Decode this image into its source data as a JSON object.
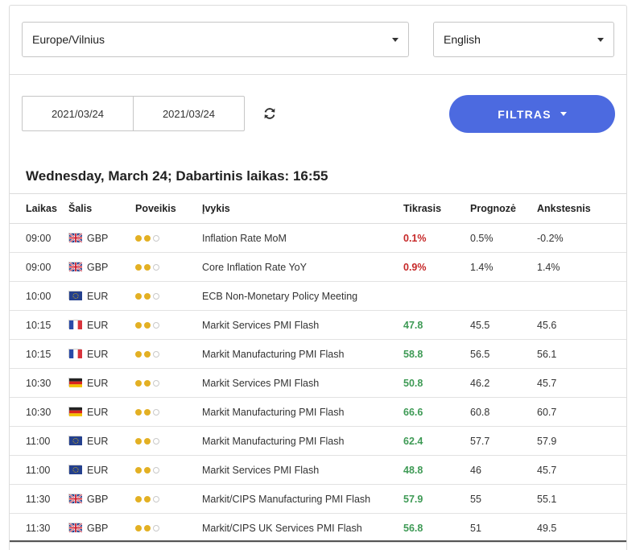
{
  "filters": {
    "timezone": "Europe/Vilnius",
    "language": "English",
    "date_from": "2021/03/24",
    "date_to": "2021/03/24",
    "filter_label": "FILTRAS"
  },
  "heading": "Wednesday, March 24; Dabartinis laikas: 16:55",
  "columns": {
    "time": "Laikas",
    "country": "Šalis",
    "impact": "Poveikis",
    "event": "Įvykis",
    "actual": "Tikrasis",
    "forecast": "Prognozė",
    "previous": "Ankstesnis"
  },
  "colors": {
    "accent": "#4c6ae0",
    "actual_up": "#3e9a55",
    "actual_down": "#c62828",
    "impact_dot": "#e3b023"
  },
  "events": [
    {
      "time": "09:00",
      "flag": "uk-flag",
      "currency": "GBP",
      "impact": 2,
      "event": "Inflation Rate MoM",
      "actual": "0.1%",
      "actual_trend": "down",
      "forecast": "0.5%",
      "previous": "-0.2%"
    },
    {
      "time": "09:00",
      "flag": "uk-flag",
      "currency": "GBP",
      "impact": 2,
      "event": "Core Inflation Rate YoY",
      "actual": "0.9%",
      "actual_trend": "down",
      "forecast": "1.4%",
      "previous": "1.4%"
    },
    {
      "time": "10:00",
      "flag": "eu-flag",
      "currency": "EUR",
      "impact": 2,
      "event": "ECB Non-Monetary Policy Meeting",
      "actual": "",
      "actual_trend": "",
      "forecast": "",
      "previous": ""
    },
    {
      "time": "10:15",
      "flag": "fr-flag",
      "currency": "EUR",
      "impact": 2,
      "event": "Markit Services PMI Flash",
      "actual": "47.8",
      "actual_trend": "up",
      "forecast": "45.5",
      "previous": "45.6"
    },
    {
      "time": "10:15",
      "flag": "fr-flag",
      "currency": "EUR",
      "impact": 2,
      "event": "Markit Manufacturing PMI Flash",
      "actual": "58.8",
      "actual_trend": "up",
      "forecast": "56.5",
      "previous": "56.1"
    },
    {
      "time": "10:30",
      "flag": "de-flag",
      "currency": "EUR",
      "impact": 2,
      "event": "Markit Services PMI Flash",
      "actual": "50.8",
      "actual_trend": "up",
      "forecast": "46.2",
      "previous": "45.7"
    },
    {
      "time": "10:30",
      "flag": "de-flag",
      "currency": "EUR",
      "impact": 2,
      "event": "Markit Manufacturing PMI Flash",
      "actual": "66.6",
      "actual_trend": "up",
      "forecast": "60.8",
      "previous": "60.7"
    },
    {
      "time": "11:00",
      "flag": "eu-flag",
      "currency": "EUR",
      "impact": 2,
      "event": "Markit Manufacturing PMI Flash",
      "actual": "62.4",
      "actual_trend": "up",
      "forecast": "57.7",
      "previous": "57.9"
    },
    {
      "time": "11:00",
      "flag": "eu-flag",
      "currency": "EUR",
      "impact": 2,
      "event": "Markit Services PMI Flash",
      "actual": "48.8",
      "actual_trend": "up",
      "forecast": "46",
      "previous": "45.7"
    },
    {
      "time": "11:30",
      "flag": "uk-flag",
      "currency": "GBP",
      "impact": 2,
      "event": "Markit/CIPS Manufacturing PMI Flash",
      "actual": "57.9",
      "actual_trend": "up",
      "forecast": "55",
      "previous": "55.1"
    },
    {
      "time": "11:30",
      "flag": "uk-flag",
      "currency": "GBP",
      "impact": 2,
      "event": "Markit/CIPS UK Services PMI Flash",
      "actual": "56.8",
      "actual_trend": "up",
      "forecast": "51",
      "previous": "49.5"
    }
  ]
}
